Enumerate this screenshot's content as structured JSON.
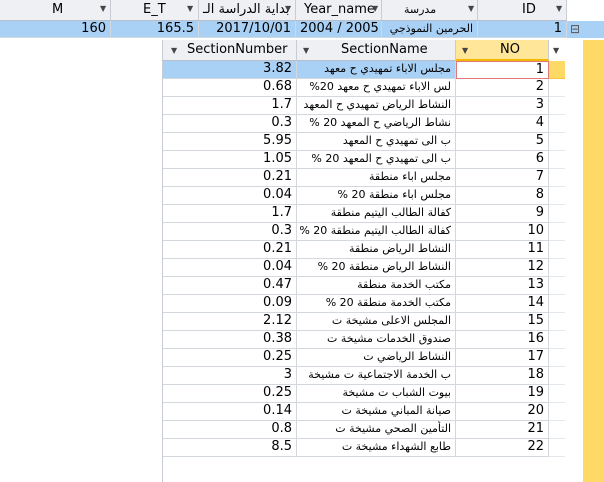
{
  "parent": {
    "columns": {
      "m": "M",
      "et": "E_T",
      "start": "بداية الدراسة الـ",
      "year": "Year_name",
      "school": "مدرسة",
      "id": "ID"
    },
    "row": {
      "m": "160",
      "et": "165.5",
      "start": "2017/10/01",
      "year": "2004 / 2005",
      "school": "الحرمين النموذجي",
      "id": "1",
      "expand": "⊟"
    }
  },
  "sub": {
    "columns": {
      "section_number": "SectionNumber",
      "section_name": "SectionName",
      "no": "NO"
    },
    "rows": [
      {
        "sn": "3.82",
        "name": "مجلس الاباء تمهيدي ح معهد",
        "no": "1"
      },
      {
        "sn": "0.68",
        "name": "لس الاباء تمهيدي ح معهد 20%",
        "no": "2"
      },
      {
        "sn": "1.7",
        "name": "النشاط الرياض تمهيدي ح المعهد",
        "no": "3"
      },
      {
        "sn": "0.3",
        "name": "نشاط الرياضي ح المعهد 20 %",
        "no": "4"
      },
      {
        "sn": "5.95",
        "name": "ب الى تمهيدي ح المعهد",
        "no": "5"
      },
      {
        "sn": "1.05",
        "name": "ب الى تمهيدي ح المعهد 20 %",
        "no": "6"
      },
      {
        "sn": "0.21",
        "name": "مجلس اباء منطقة",
        "no": "7"
      },
      {
        "sn": "0.04",
        "name": "مجلس اباء منطقة 20 %",
        "no": "8"
      },
      {
        "sn": "1.7",
        "name": "كفالة الطالب اليتيم منطقة",
        "no": "9"
      },
      {
        "sn": "0.3",
        "name": "كفالة الطالب اليتيم منطقة 20 %",
        "no": "10"
      },
      {
        "sn": "0.21",
        "name": "النشاط الرياض منطقة",
        "no": "11"
      },
      {
        "sn": "0.04",
        "name": "النشاط الرياض منطقة 20 %",
        "no": "12"
      },
      {
        "sn": "0.47",
        "name": "مكتب الخدمة منطقة",
        "no": "13"
      },
      {
        "sn": "0.09",
        "name": "مكتب الخدمة منطقة 20 %",
        "no": "14"
      },
      {
        "sn": "2.12",
        "name": "المجلس الاعلى مشيخة ت",
        "no": "15"
      },
      {
        "sn": "0.38",
        "name": "صندوق الخدمات مشيخة ت",
        "no": "16"
      },
      {
        "sn": "0.25",
        "name": "النشاط الرياضي ت",
        "no": "17"
      },
      {
        "sn": "3",
        "name": "ب الخدمة الاجتماعية ت مشيخة",
        "no": "18"
      },
      {
        "sn": "0.25",
        "name": "بيوت الشباب ت مشيخة",
        "no": "19"
      },
      {
        "sn": "0.14",
        "name": "صيانة المباني مشيخة ت",
        "no": "20"
      },
      {
        "sn": "0.8",
        "name": "التأمين الصحي مشيخة ت",
        "no": "21"
      },
      {
        "sn": "8.5",
        "name": "طابع الشهداء مشيخة ت",
        "no": "22"
      }
    ]
  },
  "colors": {
    "header_bg": "#eef0f4",
    "selected_row": "#a9d0f5",
    "row_selector_active": "#ffd966",
    "active_column_header": "#ffe699"
  }
}
